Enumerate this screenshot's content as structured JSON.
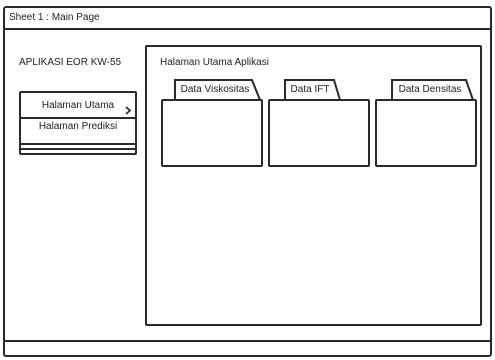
{
  "window": {
    "title": "Sheet 1 : Main Page"
  },
  "sidebar": {
    "app_name": "APLIKASI EOR KW-55",
    "items": [
      {
        "label": "Halaman Utama",
        "active": true,
        "icon": "chevron-right-icon"
      },
      {
        "label": "Halaman Prediksi",
        "active": false
      }
    ]
  },
  "main": {
    "title": "Halaman Utama Aplikasi",
    "tabs": [
      {
        "label": "Data Viskositas"
      },
      {
        "label": "Data IFT"
      },
      {
        "label": "Data Densitas"
      }
    ]
  },
  "colors": {
    "stroke": "#2a2a2a",
    "background": "#ffffff"
  }
}
